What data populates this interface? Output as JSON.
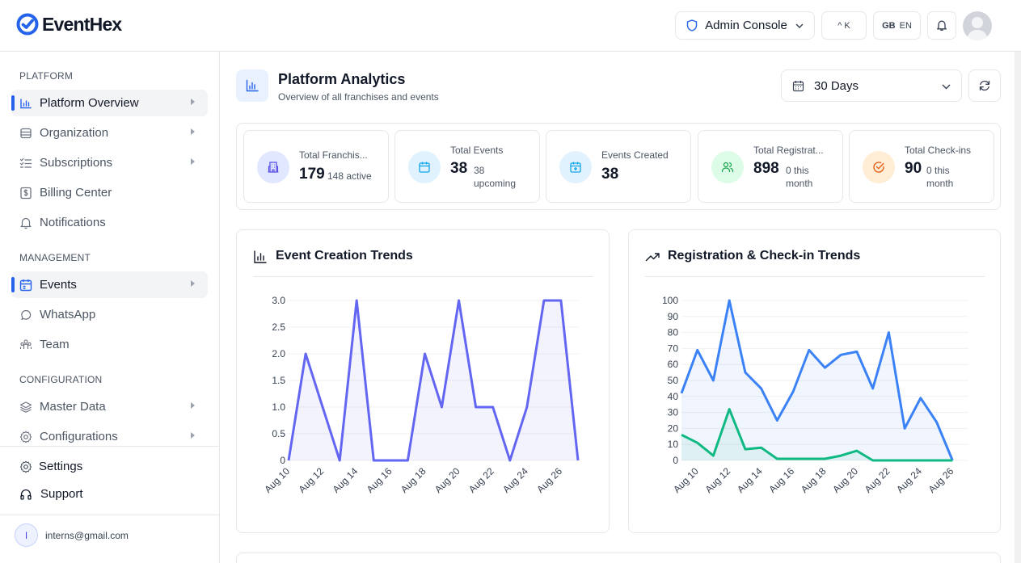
{
  "app": {
    "name": "EventHex"
  },
  "header": {
    "console_label": "Admin Console",
    "shortcut_label": "^ K",
    "lang_flag": "GB",
    "lang_code": "EN"
  },
  "sidebar": {
    "sections": [
      {
        "title": "PLATFORM",
        "items": [
          {
            "label": "Platform Overview",
            "icon": "bar-chart-icon",
            "active": true,
            "has_submenu": true
          },
          {
            "label": "Organization",
            "icon": "building-icon",
            "has_submenu": true
          },
          {
            "label": "Subscriptions",
            "icon": "list-check-icon",
            "has_submenu": true
          },
          {
            "label": "Billing Center",
            "icon": "dollar-icon"
          },
          {
            "label": "Notifications",
            "icon": "bell-icon"
          }
        ]
      },
      {
        "title": "MANAGEMENT",
        "items": [
          {
            "label": "Events",
            "icon": "calendar-icon",
            "active": true,
            "has_submenu": true
          },
          {
            "label": "WhatsApp",
            "icon": "chat-icon"
          },
          {
            "label": "Team",
            "icon": "team-icon"
          }
        ]
      },
      {
        "title": "CONFIGURATION",
        "items": [
          {
            "label": "Master Data",
            "icon": "layers-icon",
            "has_submenu": true
          },
          {
            "label": "Configurations",
            "icon": "gear-icon",
            "has_submenu": true
          }
        ]
      }
    ],
    "bottom": [
      {
        "label": "Settings",
        "icon": "gear-icon"
      },
      {
        "label": "Support",
        "icon": "headset-icon"
      }
    ],
    "user": {
      "initial": "I",
      "email": "interns@gmail.com"
    }
  },
  "page": {
    "title": "Platform Analytics",
    "subtitle": "Overview of all franchises and events",
    "range": "30 Days"
  },
  "stats": [
    {
      "label": "Total Franchis...",
      "value": "179",
      "sub": "148 active",
      "icon": "building-icon",
      "color": "#e0e7ff"
    },
    {
      "label": "Total Events",
      "value": "38",
      "sub": "38 upcoming",
      "icon": "calendar-icon",
      "color": "#e0f2fe"
    },
    {
      "label": "Events Created",
      "value": "38",
      "sub": "",
      "icon": "calendar-plus-icon",
      "color": "#e0f2fe"
    },
    {
      "label": "Total Registrat...",
      "value": "898",
      "sub": "0 this month",
      "icon": "users-icon",
      "color": "#dcfce7"
    },
    {
      "label": "Total Check-ins",
      "value": "90",
      "sub": "0 this month",
      "icon": "check-circle-icon",
      "color": "#ffedd5"
    }
  ],
  "chart_data": [
    {
      "type": "area",
      "title": "Event Creation Trends",
      "x": [
        "Aug 10",
        "Aug 11",
        "Aug 12",
        "Aug 13",
        "Aug 14",
        "Aug 15",
        "Aug 16",
        "Aug 17",
        "Aug 18",
        "Aug 19",
        "Aug 20",
        "Aug 21",
        "Aug 22",
        "Aug 23",
        "Aug 24",
        "Aug 25",
        "Aug 26",
        "Aug 27"
      ],
      "x_tick_labels": [
        "Aug 10",
        "Aug 12",
        "Aug 14",
        "Aug 16",
        "Aug 18",
        "Aug 20",
        "Aug 22",
        "Aug 24",
        "Aug 26"
      ],
      "series": [
        {
          "values": [
            0,
            2,
            1,
            0,
            3,
            0,
            0,
            0,
            2,
            1,
            3,
            1,
            1,
            0,
            1,
            3,
            3,
            0
          ],
          "color": "#6366f1"
        }
      ],
      "ylim": [
        0,
        3
      ],
      "y_ticks": [
        "0",
        "0.5",
        "1.0",
        "1.5",
        "2.0",
        "2.5",
        "3.0"
      ],
      "grid": true
    },
    {
      "type": "area",
      "title": "Registration & Check-in Trends",
      "x": [
        "Aug 9",
        "Aug 10",
        "Aug 11",
        "Aug 12",
        "Aug 13",
        "Aug 14",
        "Aug 15",
        "Aug 16",
        "Aug 17",
        "Aug 18",
        "Aug 19",
        "Aug 20",
        "Aug 21",
        "Aug 22",
        "Aug 23",
        "Aug 24",
        "Aug 25",
        "Aug 26",
        "Aug 27"
      ],
      "x_tick_labels": [
        "Aug 10",
        "Aug 12",
        "Aug 14",
        "Aug 16",
        "Aug 18",
        "Aug 20",
        "Aug 22",
        "Aug 24",
        "Aug 26"
      ],
      "series": [
        {
          "values": [
            42,
            69,
            50,
            100,
            55,
            45,
            25,
            43,
            69,
            58,
            66,
            68,
            45,
            80,
            20,
            39,
            24,
            0
          ],
          "color": "#3b82f6"
        },
        {
          "values": [
            16,
            11,
            3,
            32,
            7,
            8,
            1,
            1,
            1,
            1,
            3,
            6,
            0,
            0,
            0,
            0,
            0,
            0
          ],
          "color": "#10b981"
        }
      ],
      "ylim": [
        0,
        100
      ],
      "y_ticks": [
        "0",
        "10",
        "20",
        "30",
        "40",
        "50",
        "60",
        "70",
        "80",
        "90",
        "100"
      ],
      "grid": true
    }
  ]
}
